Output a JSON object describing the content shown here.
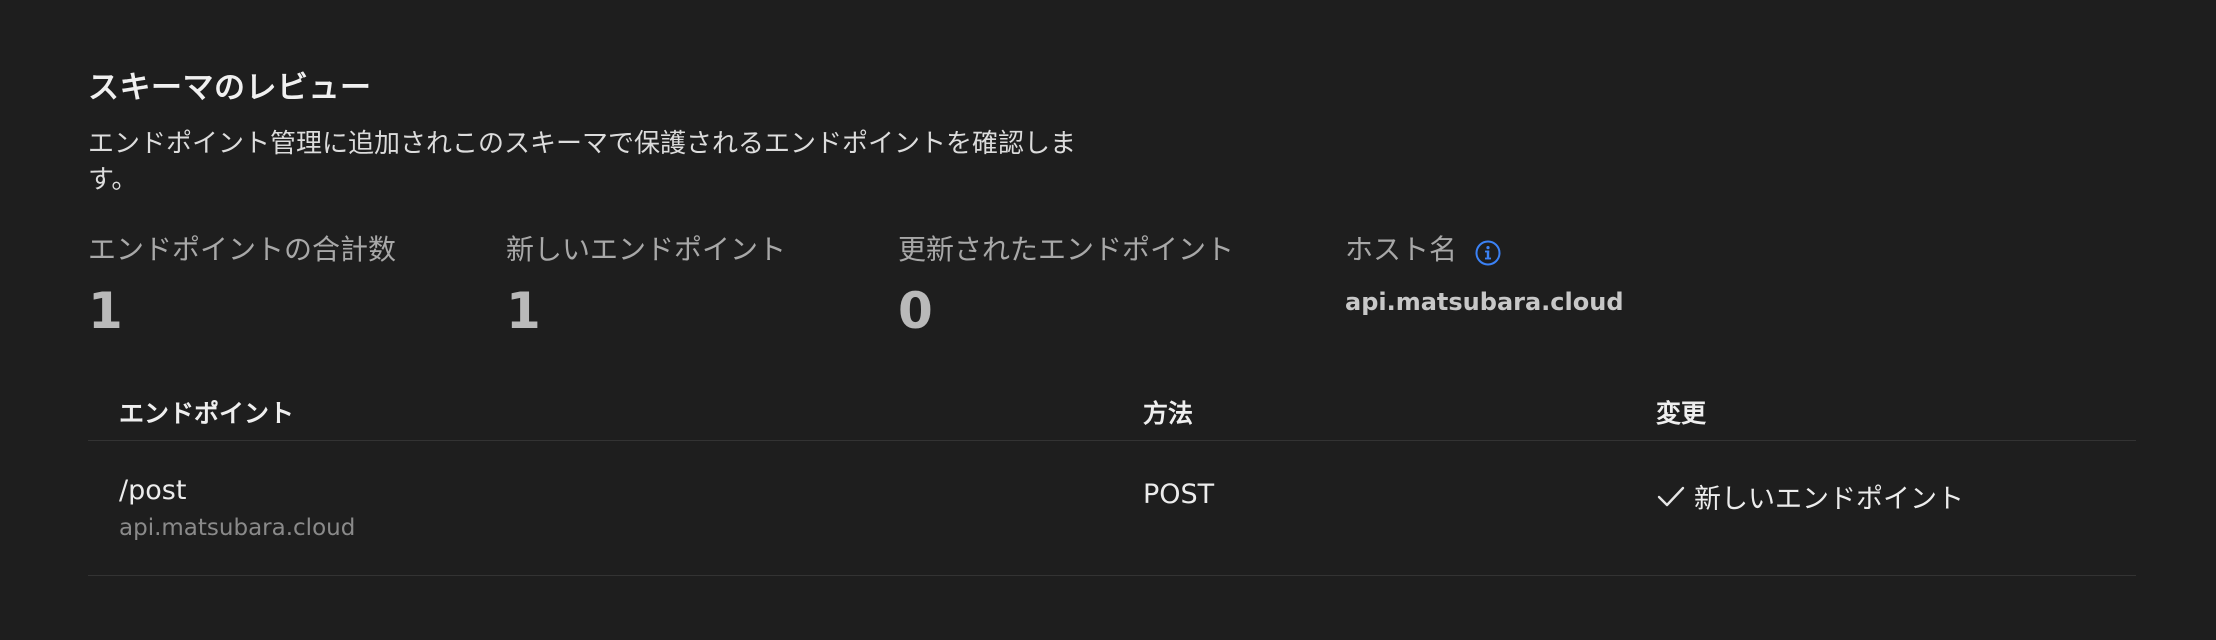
{
  "header": {
    "title": "スキーマのレビュー",
    "description": "エンドポイント管理に追加されこのスキーマで保護されるエンドポイントを確認します。"
  },
  "stats": {
    "total": {
      "label": "エンドポイントの合計数",
      "value": "1"
    },
    "new": {
      "label": "新しいエンドポイント",
      "value": "1"
    },
    "updated": {
      "label": "更新されたエンドポイント",
      "value": "0"
    },
    "hostname": {
      "label": "ホスト名",
      "value": "api.matsubara.cloud",
      "icon": "info-icon"
    }
  },
  "table": {
    "columns": {
      "endpoint": "エンドポイント",
      "method": "方法",
      "change": "変更"
    },
    "rows": [
      {
        "path": "/post",
        "host": "api.matsubara.cloud",
        "method": "POST",
        "change": "新しいエンドポイント",
        "change_icon": "check-icon"
      }
    ]
  },
  "colors": {
    "background": "#1e1e1e",
    "accent": "#3b82f6"
  }
}
